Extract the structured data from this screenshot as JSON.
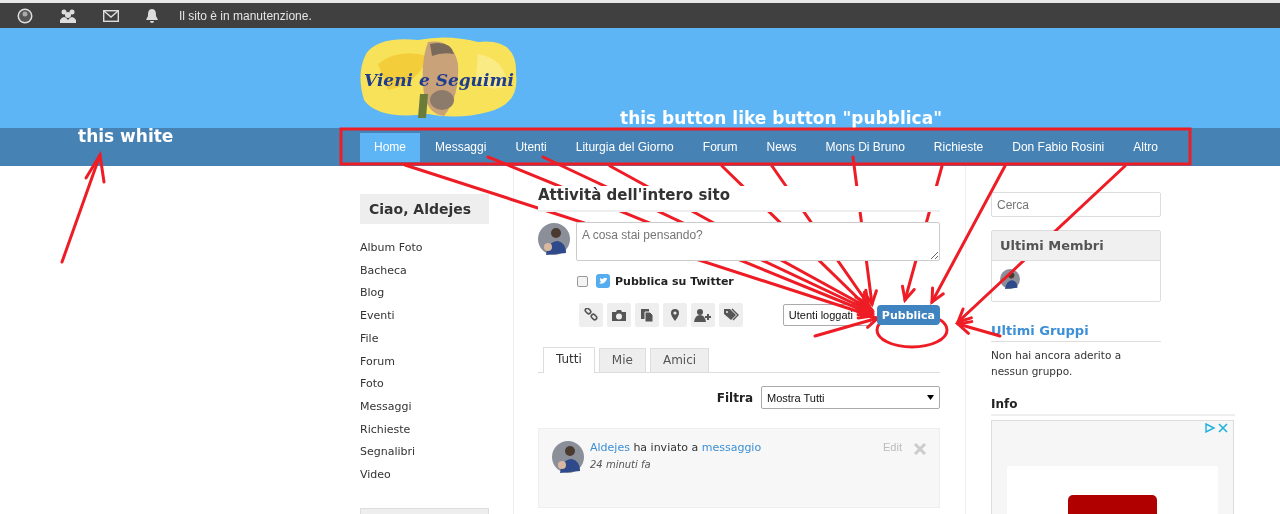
{
  "top_bar": {
    "notice": "Il sito è in manutenzione."
  },
  "header": {
    "logo_text": "Vieni e Seguimi"
  },
  "nav": [
    {
      "label": "Home",
      "selected": true
    },
    {
      "label": "Messaggi",
      "selected": false
    },
    {
      "label": "Utenti",
      "selected": false
    },
    {
      "label": "Liturgia del Giorno",
      "selected": false
    },
    {
      "label": "Forum",
      "selected": false
    },
    {
      "label": "News",
      "selected": false
    },
    {
      "label": "Mons Di Bruno",
      "selected": false
    },
    {
      "label": "Richieste",
      "selected": false
    },
    {
      "label": "Don Fabio Rosini",
      "selected": false
    },
    {
      "label": "Altro",
      "selected": false
    }
  ],
  "left": {
    "greeting": "Ciao, Aldejes",
    "links": [
      "Album Foto",
      "Bacheca",
      "Blog",
      "Eventi",
      "File",
      "Forum",
      "Foto",
      "Messaggi",
      "Richieste",
      "Segnalibri",
      "Video"
    ]
  },
  "main": {
    "title": "Attività dell'intero sito",
    "composer": {
      "placeholder": "A cosa stai pensando?",
      "twitter": {
        "label": "Pubblica su Twitter",
        "checked": false
      },
      "visibility": "Utenti loggati",
      "submit": "Pubblica"
    },
    "tabs": [
      {
        "label": "Tutti",
        "selected": true
      },
      {
        "label": "Mie",
        "selected": false
      },
      {
        "label": "Amici",
        "selected": false
      }
    ],
    "filter": {
      "label": "Filtra",
      "value": "Mostra Tutti"
    },
    "activity": [
      {
        "user": "Aldejes",
        "action": "ha inviato a",
        "object": "messaggio",
        "time": "24 minuti fa",
        "edit": "Edit"
      }
    ]
  },
  "right": {
    "search_placeholder": "Cerca",
    "members_title": "Ultimi Membri",
    "groups_title": "Ultimi Gruppi",
    "groups_empty": "Non hai ancora aderito a nessun gruppo.",
    "info_title": "Info"
  },
  "annotations": [
    {
      "text": "this white"
    },
    {
      "text": "this button like button \"pubblica\""
    }
  ]
}
